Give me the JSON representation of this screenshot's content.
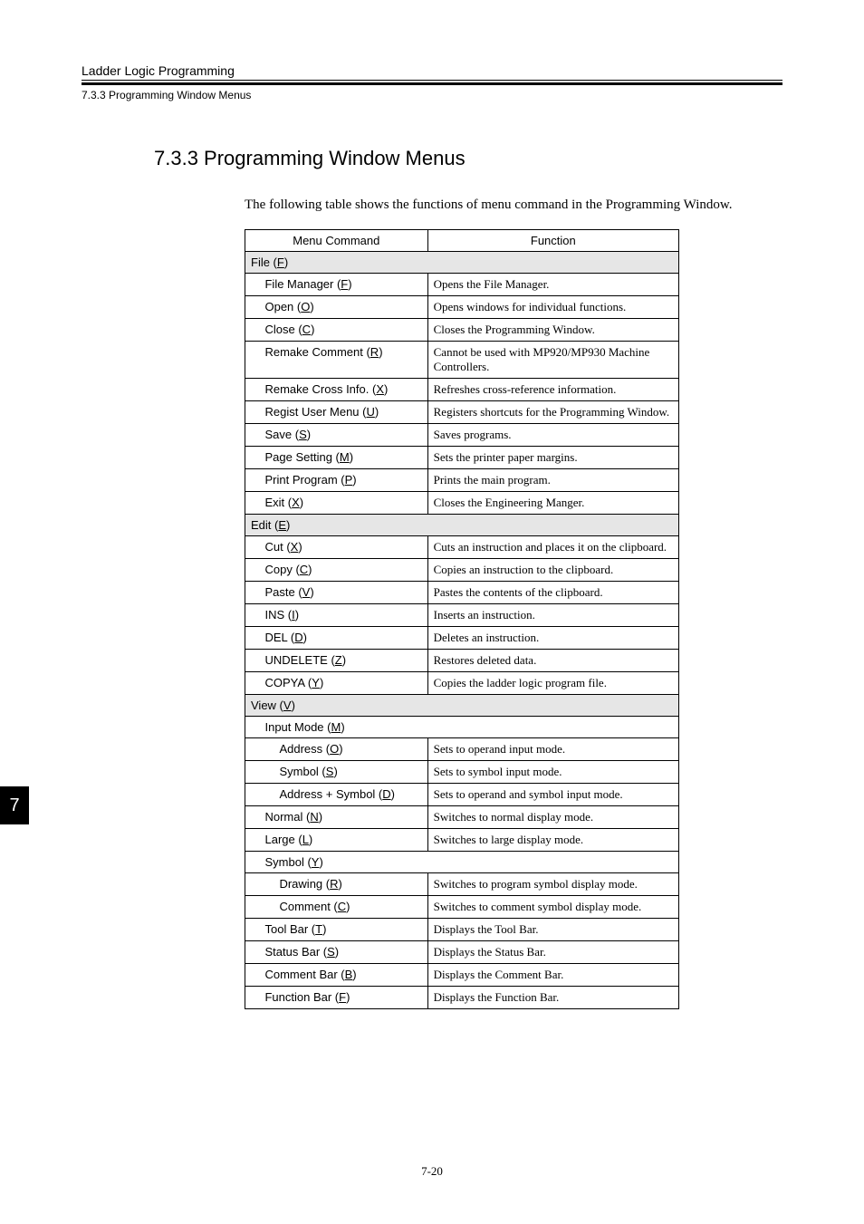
{
  "header": {
    "top": "Ladder Logic Programming",
    "sub": "7.3.3  Programming Window Menus"
  },
  "section_title": "7.3.3  Programming Window Menus",
  "intro": "The following table shows the functions of menu command in the Programming Window.",
  "table": {
    "headers": {
      "cmd": "Menu Command",
      "func": "Function"
    },
    "groups": [
      {
        "label_pre": "File (",
        "label_u": "F",
        "label_post": ")",
        "rows": [
          {
            "indent": 1,
            "pre": "File Manager (",
            "u": "F",
            "post": ")",
            "func": "Opens the File Manager."
          },
          {
            "indent": 1,
            "pre": "Open (",
            "u": "O",
            "post": ")",
            "func": "Opens windows for individual functions."
          },
          {
            "indent": 1,
            "pre": "Close (",
            "u": "C",
            "post": ")",
            "func": "Closes the Programming Window."
          },
          {
            "indent": 1,
            "pre": "Remake Comment (",
            "u": "R",
            "post": ")",
            "func": "Cannot be used with MP920/MP930 Machine Controllers."
          },
          {
            "indent": 1,
            "pre": "Remake Cross Info. (",
            "u": "X",
            "post": ")",
            "func": "Refreshes cross-reference information."
          },
          {
            "indent": 1,
            "pre": "Regist User Menu (",
            "u": "U",
            "post": ")",
            "func": "Registers shortcuts for the Programming Window."
          },
          {
            "indent": 1,
            "pre": "Save (",
            "u": "S",
            "post": ")",
            "func": "Saves programs."
          },
          {
            "indent": 1,
            "pre": "Page Setting (",
            "u": "M",
            "post": ")",
            "func": "Sets the printer paper margins."
          },
          {
            "indent": 1,
            "pre": "Print Program (",
            "u": "P",
            "post": ")",
            "func": "Prints the main program."
          },
          {
            "indent": 1,
            "pre": "Exit (",
            "u": "X",
            "post": ")",
            "func": "Closes the Engineering Manger."
          }
        ]
      },
      {
        "label_pre": "Edit (",
        "label_u": "E",
        "label_post": ")",
        "rows": [
          {
            "indent": 1,
            "pre": "Cut (",
            "u": "X",
            "post": ")",
            "func": "Cuts an instruction and places it on the clipboard."
          },
          {
            "indent": 1,
            "pre": "Copy (",
            "u": "C",
            "post": ")",
            "func": "Copies an instruction to the clipboard."
          },
          {
            "indent": 1,
            "pre": "Paste (",
            "u": "V",
            "post": ")",
            "func": "Pastes the contents of the clipboard."
          },
          {
            "indent": 1,
            "pre": "INS (",
            "u": "I",
            "post": ")",
            "func": "Inserts an instruction."
          },
          {
            "indent": 1,
            "pre": "DEL (",
            "u": "D",
            "post": ")",
            "func": "Deletes an instruction."
          },
          {
            "indent": 1,
            "pre": "UNDELETE (",
            "u": "Z",
            "post": ")",
            "func": "Restores deleted data."
          },
          {
            "indent": 1,
            "pre": "COPYA (",
            "u": "Y",
            "post": ")",
            "func": "Copies the ladder logic program file."
          }
        ]
      },
      {
        "label_pre": "View (",
        "label_u": "V",
        "label_post": ")",
        "rows": [
          {
            "indent": 1,
            "subgroup": true,
            "pre": "Input Mode (",
            "u": "M",
            "post": ")"
          },
          {
            "indent": 2,
            "pre": "Address (",
            "u": "O",
            "post": ")",
            "func": "Sets to operand input mode."
          },
          {
            "indent": 2,
            "pre": "Symbol (",
            "u": "S",
            "post": ")",
            "func": "Sets to symbol input mode."
          },
          {
            "indent": 2,
            "pre": "Address + Symbol (",
            "u": "D",
            "post": ")",
            "func": "Sets to operand and symbol input mode."
          },
          {
            "indent": 1,
            "pre": "Normal (",
            "u": "N",
            "post": ")",
            "func": "Switches to normal display mode."
          },
          {
            "indent": 1,
            "pre": "Large (",
            "u": "L",
            "post": ")",
            "func": "Switches to large display mode."
          },
          {
            "indent": 1,
            "subgroup": true,
            "pre": "Symbol (",
            "u": "Y",
            "post": ")"
          },
          {
            "indent": 2,
            "pre": "Drawing (",
            "u": "R",
            "post": ")",
            "func": "Switches to program symbol display mode."
          },
          {
            "indent": 2,
            "pre": "Comment (",
            "u": "C",
            "post": ")",
            "func": "Switches to comment symbol display mode."
          },
          {
            "indent": 1,
            "pre": "Tool Bar (",
            "u": "T",
            "post": ")",
            "func": "Displays the Tool Bar."
          },
          {
            "indent": 1,
            "pre": "Status Bar (",
            "u": "S",
            "post": ")",
            "func": "Displays the Status Bar."
          },
          {
            "indent": 1,
            "pre": "Comment Bar (",
            "u": "B",
            "post": ")",
            "func": "Displays the Comment Bar."
          },
          {
            "indent": 1,
            "pre": "Function Bar (",
            "u": "F",
            "post": ")",
            "func": "Displays the Function Bar."
          }
        ]
      }
    ]
  },
  "chapter_tab": "7",
  "page_number": "7-20"
}
